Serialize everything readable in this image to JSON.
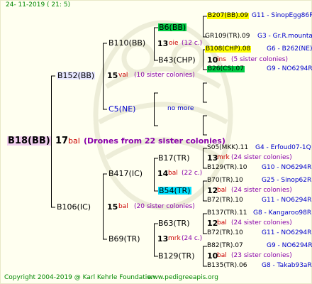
{
  "header": {
    "date": "24- 11-2019 ( 21: 5)"
  },
  "footer": {
    "copyright": "Copyright 2004-2019 @ Karl Kehrle Foundation",
    "url": "www.pedigreeapis.org"
  },
  "root": {
    "name": "B18(BB)",
    "count": "17",
    "code": "bal",
    "note": "(Drones from 22 sister colonies)"
  },
  "gen1": {
    "top": {
      "name": "B152(BB)",
      "count": "15",
      "code": "val",
      "note": "(10 sister colonies)"
    },
    "bottom": {
      "name": "B106(IC)",
      "count": "15",
      "code": "bal",
      "note": "(20 sister colonies)"
    }
  },
  "gen2": {
    "a": {
      "name": "B110(BB)"
    },
    "b": {
      "name": "C5(NE)",
      "note": "no more"
    },
    "c": {
      "name": "B417(IC)",
      "count": "14",
      "code": "bal",
      "note": "(22 c.)"
    },
    "d": {
      "name": "B69(TR)",
      "count": "13",
      "code": "mrk",
      "note": "(24 c.)"
    }
  },
  "gen3": {
    "a1": {
      "name": "B6(BB)",
      "count": "13",
      "code": "oie",
      "note": "(12 c.)"
    },
    "a2": {
      "name": "B43(CHP)",
      "count": "10",
      "code": "ins",
      "note": "(5 sister colonies)"
    },
    "c1": {
      "name": "B17(TR)",
      "count": "13",
      "code": "mrk",
      "note": "(24 sister colonies)"
    },
    "c2": {
      "name": "B54(TR)",
      "count": "12",
      "code": "bal",
      "note": "(24 sister colonies)"
    },
    "d1": {
      "name": "B63(TR)",
      "count": "12",
      "code": "bal",
      "note": "(24 sister colonies)"
    },
    "d2": {
      "name": "B129(TR)",
      "count": "10",
      "code": "bal",
      "note": "(23 sister colonies)"
    }
  },
  "gen4": [
    {
      "name": "B207(BB).09",
      "info": "G11 - SinopEgg86R",
      "style": "yellow"
    },
    {
      "name": "GR109(TR).09",
      "info": "G3 - Gr.R.mounta",
      "style": "none"
    },
    {
      "name": "B108(CHP).08",
      "info": "G6 - B262(NE)",
      "style": "yellow"
    },
    {
      "name": "B26(CS).07",
      "info": "G9 - NO6294R",
      "style": "green"
    },
    {
      "name": "S05(MKK).11",
      "info": "G4 - Erfoud07-1Q",
      "style": "none"
    },
    {
      "name": "B129(TR).10",
      "info": "G10 - NO6294R",
      "style": "none"
    },
    {
      "name": "B70(TR).10",
      "info": "G25 - Sinop62R",
      "style": "none"
    },
    {
      "name": "B72(TR).10",
      "info": "G11 - NO6294R",
      "style": "none"
    },
    {
      "name": "B137(TR).11",
      "info": "G8 - Kangaroo98R",
      "style": "none"
    },
    {
      "name": "B72(TR).10",
      "info": "G11 - NO6294R",
      "style": "none"
    },
    {
      "name": "B82(TR).07",
      "info": "G9 - NO6294R",
      "style": "none"
    },
    {
      "name": "B135(TR).06",
      "info": "G8 - Takab93aR",
      "style": "none"
    }
  ]
}
